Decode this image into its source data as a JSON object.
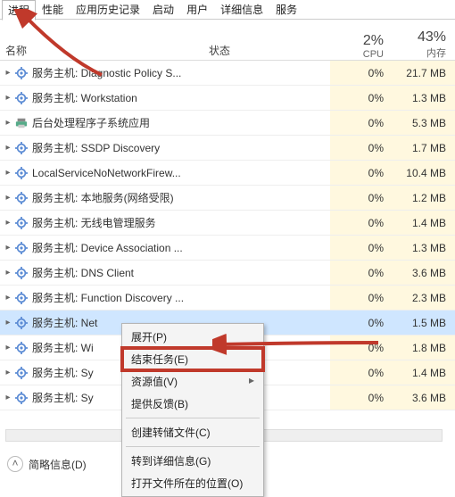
{
  "tabs": {
    "items": [
      {
        "label": "进程",
        "active": true
      },
      {
        "label": "性能",
        "active": false
      },
      {
        "label": "应用历史记录",
        "active": false
      },
      {
        "label": "启动",
        "active": false
      },
      {
        "label": "用户",
        "active": false
      },
      {
        "label": "详细信息",
        "active": false
      },
      {
        "label": "服务",
        "active": false
      }
    ]
  },
  "columns": {
    "name": "名称",
    "status": "状态",
    "cpu_pct": "2%",
    "cpu_label": "CPU",
    "mem_pct": "43%",
    "mem_label": "内存"
  },
  "rows": [
    {
      "name": "服务主机: Diagnostic Policy S...",
      "cpu": "0%",
      "mem": "21.7 MB",
      "icon": "gear"
    },
    {
      "name": "服务主机: Workstation",
      "cpu": "0%",
      "mem": "1.3 MB",
      "icon": "gear"
    },
    {
      "name": "后台处理程序子系统应用",
      "cpu": "0%",
      "mem": "5.3 MB",
      "icon": "printer"
    },
    {
      "name": "服务主机: SSDP Discovery",
      "cpu": "0%",
      "mem": "1.7 MB",
      "icon": "gear"
    },
    {
      "name": "LocalServiceNoNetworkFirew...",
      "cpu": "0%",
      "mem": "10.4 MB",
      "icon": "gear"
    },
    {
      "name": "服务主机: 本地服务(网络受限)",
      "cpu": "0%",
      "mem": "1.2 MB",
      "icon": "gear"
    },
    {
      "name": "服务主机: 无线电管理服务",
      "cpu": "0%",
      "mem": "1.4 MB",
      "icon": "gear"
    },
    {
      "name": "服务主机: Device Association ...",
      "cpu": "0%",
      "mem": "1.3 MB",
      "icon": "gear"
    },
    {
      "name": "服务主机: DNS Client",
      "cpu": "0%",
      "mem": "3.6 MB",
      "icon": "gear"
    },
    {
      "name": "服务主机: Function Discovery ...",
      "cpu": "0%",
      "mem": "2.3 MB",
      "icon": "gear"
    },
    {
      "name": "服务主机: Net",
      "cpu": "0%",
      "mem": "1.5 MB",
      "icon": "gear",
      "selected": true
    },
    {
      "name": "服务主机: Wi",
      "cpu": "0%",
      "mem": "1.8 MB",
      "icon": "gear"
    },
    {
      "name": "服务主机: Sy",
      "cpu": "0%",
      "mem": "1.4 MB",
      "icon": "gear"
    },
    {
      "name": "服务主机: Sy",
      "cpu": "0%",
      "mem": "3.6 MB",
      "icon": "gear"
    }
  ],
  "context_menu": {
    "items": [
      {
        "label": "展开(P)",
        "enabled": true,
        "highlight": false
      },
      {
        "label": "结束任务(E)",
        "enabled": true,
        "highlight": true
      },
      {
        "label": "资源值(V)",
        "enabled": true,
        "submenu": true
      },
      {
        "label": "提供反馈(B)",
        "enabled": true
      },
      {
        "sep": true
      },
      {
        "label": "创建转储文件(C)",
        "enabled": true
      },
      {
        "sep": true
      },
      {
        "label": "转到详细信息(G)",
        "enabled": true
      },
      {
        "label": "打开文件所在的位置(O)",
        "enabled": true
      }
    ]
  },
  "footer": {
    "brief_label": "简略信息(D)"
  },
  "colors": {
    "heat_bg": "#fff8df",
    "selection": "#cfe6ff",
    "highlight_box": "#c0392b",
    "arrow": "#c0392b"
  }
}
